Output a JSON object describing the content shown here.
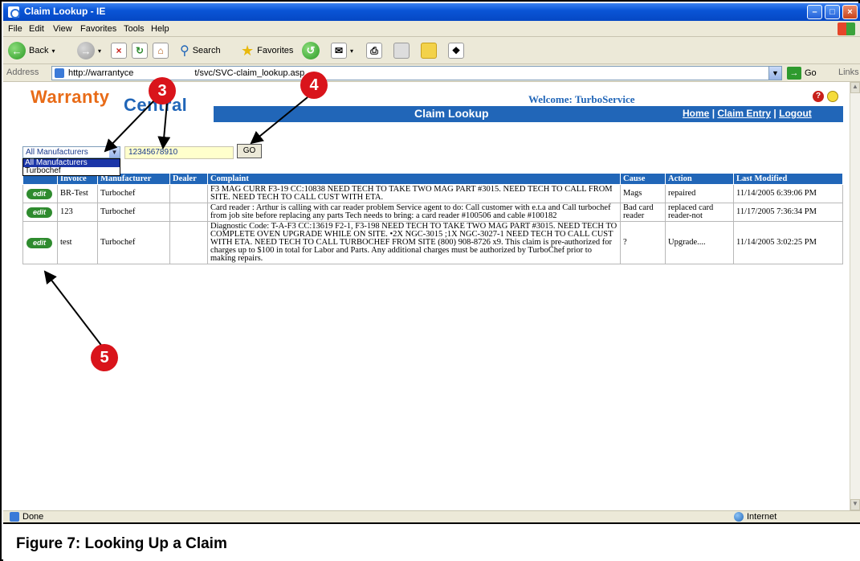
{
  "window": {
    "title": "Claim Lookup - IE"
  },
  "menu": [
    "File",
    "Edit",
    "View",
    "Favorites",
    "Tools",
    "Help"
  ],
  "toolbar": {
    "back": "Back",
    "search": "Search",
    "favorites": "Favorites"
  },
  "address": {
    "label": "Address",
    "url": "http://warrantyce",
    "url_rest": "t/svc/SVC-claim_lookup.asp",
    "go": "Go",
    "links": "Links"
  },
  "site": {
    "logo_warranty": "Warranty",
    "logo_central": "Central",
    "welcome": "Welcome: TurboService",
    "page_title": "Claim Lookup",
    "nav": {
      "home": "Home",
      "claim_entry": "Claim Entry",
      "logout": "Logout",
      "sep": "|"
    }
  },
  "lookup": {
    "manufacturer_value": "All Manufacturers",
    "manufacturer_options": [
      "All Manufacturers",
      "Turbochef"
    ],
    "claim_number": "12345678910",
    "go_label": "GO"
  },
  "table": {
    "headers": [
      "",
      "Invoice",
      "Manufacturer",
      "Dealer",
      "Complaint",
      "Cause",
      "Action",
      "Last Modified"
    ],
    "edit_label": "edit",
    "rows": [
      {
        "invoice": "BR-Test",
        "manufacturer": "Turbochef",
        "dealer": "",
        "complaint": "F3 MAG CURR F3-19 CC:10838 NEED TECH TO TAKE TWO MAG PART #3015. NEED TECH TO CALL FROM SITE. NEED TECH TO CALL CUST WITH ETA.",
        "cause": "Mags",
        "action": "repaired",
        "last_modified": "11/14/2005 6:39:06 PM"
      },
      {
        "invoice": "123",
        "manufacturer": "Turbochef",
        "dealer": "",
        "complaint": "Card reader : Arthur is calling with car reader problem Service agent to do: Call customer with e.t.a and Call turbochef from job site before replacing any parts Tech needs to bring: a card reader #100506 and cable #100182",
        "cause": "Bad card reader",
        "action": "replaced card reader-not",
        "last_modified": "11/17/2005 7:36:34 PM"
      },
      {
        "invoice": "test",
        "manufacturer": "Turbochef",
        "dealer": "",
        "complaint": "Diagnostic Code: T-A-F3 CC:13619 F2-1, F3-198 NEED TECH TO TAKE TWO MAG PART #3015. NEED TECH TO COMPLETE OVEN UPGRADE WHILE ON SITE. •2X NGC-3015 ;1X NGC-3027-1 NEED TECH TO CALL CUST WITH ETA. NEED TECH TO CALL TURBOCHEF FROM SITE (800) 908-8726 x9. This claim is pre-authorized for charges up to $100 in total for Labor and Parts. Any additional charges must be authorized by TurboChef prior to making repairs.",
        "cause": "?",
        "action": "Upgrade....",
        "last_modified": "11/14/2005 3:02:25 PM"
      }
    ]
  },
  "status": {
    "left": "Done",
    "zone": "Internet"
  },
  "callouts": {
    "c3": "3",
    "c4": "4",
    "c5": "5"
  },
  "caption": "Figure 7: Looking Up a Claim",
  "colors": {
    "accent_blue": "#2166b8",
    "logo_orange": "#e86b17",
    "callout_red": "#d9141b",
    "edit_green": "#2e8b2e"
  }
}
